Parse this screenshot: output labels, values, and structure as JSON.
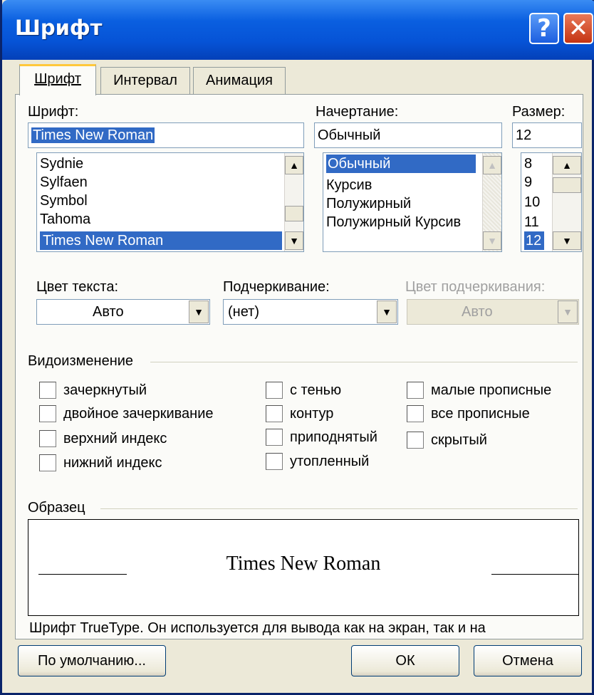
{
  "window": {
    "title": "Шрифт",
    "help_glyph": "?",
    "close_glyph": "✕"
  },
  "tabs": [
    {
      "label": "Шрифт",
      "active": true
    },
    {
      "label": "Интервал",
      "active": false
    },
    {
      "label": "Анимация",
      "active": false
    }
  ],
  "font": {
    "label": "Шрифт:",
    "value": "Times New Roman",
    "list": [
      "Sydnie",
      "Sylfaen",
      "Symbol",
      "Tahoma",
      "Times New Roman"
    ],
    "selected": "Times New Roman"
  },
  "style": {
    "label": "Начертание:",
    "value": "Обычный",
    "list": [
      "Обычный",
      "Курсив",
      "Полужирный",
      "Полужирный Курсив"
    ],
    "selected": "Обычный"
  },
  "size": {
    "label": "Размер:",
    "value": "12",
    "list": [
      "8",
      "9",
      "10",
      "11",
      "12"
    ],
    "selected": "12"
  },
  "text_color": {
    "label": "Цвет текста:",
    "value": "Авто"
  },
  "underline": {
    "label": "Подчеркивание:",
    "value": "(нет)"
  },
  "underline_color": {
    "label": "Цвет подчеркивания:",
    "value": "Авто",
    "disabled": true
  },
  "effects": {
    "title": "Видоизменение",
    "col1": [
      "зачеркнутый",
      "двойное зачеркивание",
      "верхний индекс",
      "нижний индекс"
    ],
    "col2": [
      "с тенью",
      "контур",
      "приподнятый",
      "утопленный"
    ],
    "col3": [
      "малые прописные",
      "все прописные",
      "скрытый"
    ]
  },
  "sample": {
    "title": "Образец",
    "text": "Times New Roman",
    "description": "Шрифт TrueType. Он используется для вывода как на экран, так и на"
  },
  "buttons": {
    "default": "По умолчанию...",
    "ok": "ОК",
    "cancel": "Отмена"
  },
  "colors": {
    "titlebar": "#0653d6",
    "selection": "#316ac5",
    "dialog_bg": "#ece9d8"
  }
}
